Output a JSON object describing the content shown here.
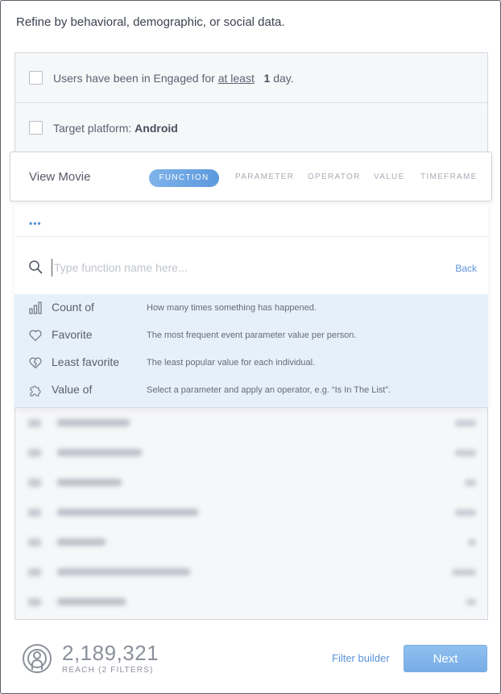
{
  "heading": "Refine by behavioral, demographic, or social data.",
  "filters": [
    {
      "prefix": "Users have been in Engaged for",
      "link": "at least",
      "value": "1",
      "suffix": "day."
    },
    {
      "prefix": "Target platform:",
      "value": "Android"
    }
  ],
  "editor": {
    "title": "View Movie",
    "steps": [
      "FUNCTION",
      "PARAMETER",
      "OPERATOR",
      "VALUE",
      "TIMEFRAME"
    ],
    "active_step": "FUNCTION",
    "more": "•••"
  },
  "search": {
    "placeholder": "Type function name here...",
    "value": "",
    "back_label": "Back"
  },
  "functions": [
    {
      "name": "Count of",
      "icon": "bar-chart-icon",
      "description": "How many times something has happened."
    },
    {
      "name": "Favorite",
      "icon": "heart-icon",
      "description": "The most frequent event parameter value per person."
    },
    {
      "name": "Least favorite",
      "icon": "broken-heart-icon",
      "description": "The least popular value for each individual."
    },
    {
      "name": "Value of",
      "icon": "puzzle-icon",
      "description": "Select a parameter and apply an operator, e.g. “Is In The List”."
    }
  ],
  "footer": {
    "reach_count": "2,189,321",
    "reach_label": "REACH (2 FILTERS)",
    "filter_builder": "Filter builder",
    "next": "Next"
  },
  "colors": {
    "accent": "#5b93d9",
    "highlight": "#e6f0fa"
  }
}
